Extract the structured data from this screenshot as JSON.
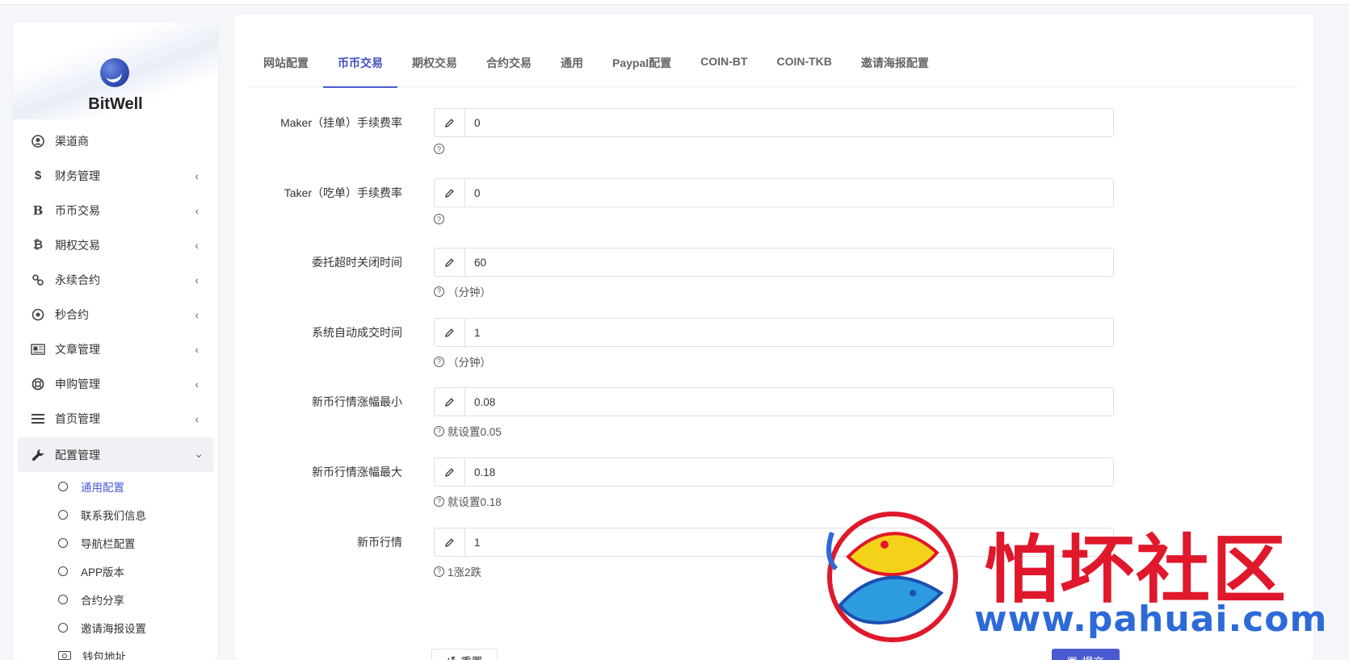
{
  "brand": {
    "name": "BitWell"
  },
  "sidebar": {
    "items": [
      {
        "label": "渠道商",
        "icon": "user-circle-icon",
        "has_arrow": false
      },
      {
        "label": "财务管理",
        "icon": "dollar-icon",
        "has_arrow": true
      },
      {
        "label": "币币交易",
        "icon": "b-letter-icon",
        "has_arrow": true
      },
      {
        "label": "期权交易",
        "icon": "bitcoin-icon",
        "has_arrow": true
      },
      {
        "label": "永续合约",
        "icon": "link-icon",
        "has_arrow": true
      },
      {
        "label": "秒合约",
        "icon": "target-icon",
        "has_arrow": true
      },
      {
        "label": "文章管理",
        "icon": "newspaper-icon",
        "has_arrow": true
      },
      {
        "label": "申购管理",
        "icon": "lifebuoy-icon",
        "has_arrow": true
      },
      {
        "label": "首页管理",
        "icon": "list-icon",
        "has_arrow": true
      },
      {
        "label": "配置管理",
        "icon": "wrench-icon",
        "has_arrow": true,
        "expanded": true
      }
    ],
    "subitems": [
      {
        "label": "通用配置",
        "selected": true
      },
      {
        "label": "联系我们信息"
      },
      {
        "label": "导航栏配置"
      },
      {
        "label": "APP版本"
      },
      {
        "label": "合约分享"
      },
      {
        "label": "邀请海报设置"
      },
      {
        "label": "钱包地址",
        "icon": "wallet-icon"
      }
    ]
  },
  "tabs": [
    {
      "label": "网站配置"
    },
    {
      "label": "币币交易",
      "active": true
    },
    {
      "label": "期权交易"
    },
    {
      "label": "合约交易"
    },
    {
      "label": "通用"
    },
    {
      "label": "Paypal配置"
    },
    {
      "label": "COIN-BT"
    },
    {
      "label": "COIN-TKB"
    },
    {
      "label": "邀请海报配置"
    }
  ],
  "form": {
    "fields": [
      {
        "label": "Maker（挂单）手续费率",
        "value": "0",
        "help": ""
      },
      {
        "label": "Taker（吃单）手续费率",
        "value": "0",
        "help": ""
      },
      {
        "label": "委托超时关闭时间",
        "value": "60",
        "help": "（分钟）"
      },
      {
        "label": "系统自动成交时间",
        "value": "1",
        "help": "（分钟）"
      },
      {
        "label": "新币行情涨幅最小",
        "value": "0.08",
        "help": "就设置0.05"
      },
      {
        "label": "新币行情涨幅最大",
        "value": "0.18",
        "help": "就设置0.18"
      },
      {
        "label": "新币行情",
        "value": "1",
        "help": "1涨2跌"
      }
    ],
    "reset_label": "重置",
    "submit_label": "提交"
  },
  "watermark": {
    "text": "怕坏社区",
    "url": "www.pahuai.com"
  },
  "colors": {
    "accent": "#4a5bd1",
    "watermark_red": "#e0182b",
    "watermark_blue": "#2d6ad8"
  }
}
